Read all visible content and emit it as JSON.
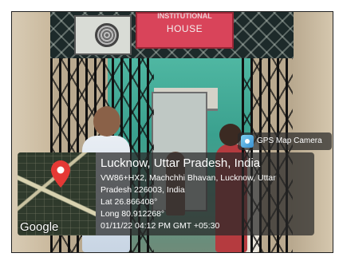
{
  "signboard": {
    "top_text": "INSTITUTIONAL",
    "bottom_text": "HOUSE"
  },
  "gps_header": {
    "label": "GPS Map Camera",
    "icon": "camera-icon"
  },
  "gps": {
    "city": "Lucknow, Uttar Pradesh, India",
    "address_line1": "VW86+HX2, Machchhi Bhavan, Lucknow, Uttar",
    "address_line2": "Pradesh 226003, India",
    "lat": "Lat 26.866408°",
    "long": "Long 80.912268°",
    "datetime": "01/11/22 04:12 PM GMT +05:30"
  },
  "map": {
    "wordmark": "Google",
    "pin_icon": "map-pin-icon",
    "pin_color": "#e53935"
  }
}
